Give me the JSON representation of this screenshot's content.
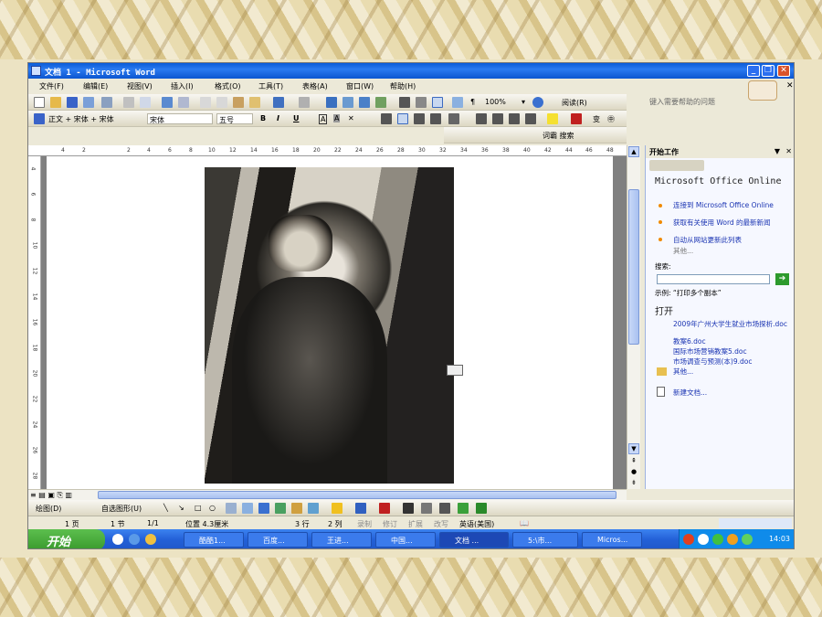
{
  "window": {
    "title": "文档 1 - Microsoft Word",
    "help_placeholder": "键入需要帮助的问题"
  },
  "menu": [
    "文件(F)",
    "编辑(E)",
    "视图(V)",
    "插入(I)",
    "格式(O)",
    "工具(T)",
    "表格(A)",
    "窗口(W)",
    "帮助(H)"
  ],
  "toolbar": {
    "zoom": "100%",
    "read_label": "阅读(R)",
    "style": "正文 + 宋体 + 宋体",
    "font": "宋体",
    "size": "五号",
    "search_label": "词霸 搜索"
  },
  "ruler": {
    "ticks": [
      "4",
      "2",
      "2",
      "4",
      "6",
      "8",
      "10",
      "12",
      "14",
      "16",
      "18",
      "20",
      "22",
      "24",
      "26",
      "28",
      "30",
      "32",
      "34",
      "36",
      "38",
      "40",
      "42",
      "44",
      "46",
      "48"
    ],
    "vticks": [
      "4",
      "6",
      "8",
      "10",
      "12",
      "14",
      "16",
      "18",
      "20",
      "22",
      "24",
      "26",
      "28"
    ]
  },
  "task_pane": {
    "title": "开始工作",
    "office_online": "Microsoft Office Online",
    "links": [
      "连接到 Microsoft Office Online",
      "获取有关使用 Word 的最新新闻",
      "自动从网站更新此列表"
    ],
    "more": "其他...",
    "search_label": "搜索:",
    "example": "示例: “打印多个副本”",
    "open_header": "打开",
    "recent": [
      "2009年广州大学生就业市场探析.doc",
      "教案6.doc",
      "国际市场营销教案5.doc",
      "市场调查与预测(本)9.doc"
    ],
    "open_more": "其他...",
    "new_doc": "新建文档..."
  },
  "drawbar": {
    "draw": "绘图(D)",
    "autoshape": "自选图形(U)"
  },
  "status": {
    "page": "1 页",
    "section": "1 节",
    "pages": "1/1",
    "position": "位置 4.3厘米",
    "line": "3 行",
    "col": "2 列",
    "rec": "录制",
    "trk": "修订",
    "ext": "扩展",
    "ovr": "改写",
    "lang": "英语(美国)"
  },
  "taskbar": {
    "start": "开始",
    "tasks": [
      "酷酷1...",
      "百度...",
      "王进...",
      "中国...",
      "文档 ...",
      "5:\\市...",
      "Micros..."
    ],
    "active_index": 4,
    "clock": "14:03"
  }
}
